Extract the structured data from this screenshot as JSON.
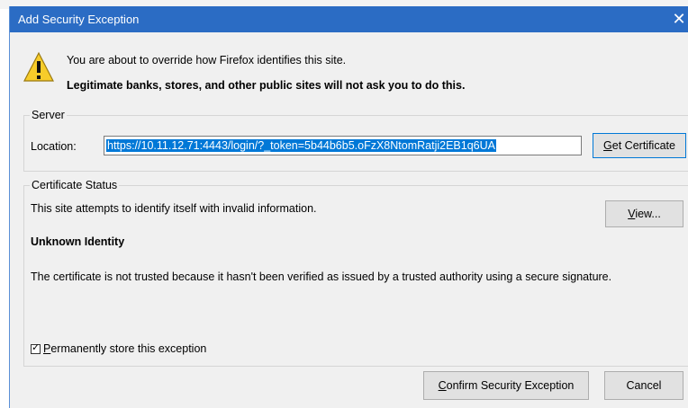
{
  "dialog": {
    "title": "Add Security Exception",
    "close_glyph": "✕"
  },
  "warning": {
    "icon": "warning-triangle-icon",
    "line1": "You are about to override how Firefox identifies this site.",
    "line2": "Legitimate banks, stores, and other public sites will not ask you to do this."
  },
  "server": {
    "legend": "Server",
    "location_label": "Location:",
    "location_value": "https://10.11.12.71:4443/login/?_token=5b44b6b5.oFzX8NtomRatji2EB1q6UA",
    "get_certificate_first": "G",
    "get_certificate_rest": "et Certificate"
  },
  "status": {
    "legend": "Certificate Status",
    "message": "This site attempts to identify itself with invalid information.",
    "view_first": "V",
    "view_rest": "iew...",
    "identity_heading": "Unknown Identity",
    "trust_message": "The certificate is not trusted because it hasn't been verified as issued by a trusted authority using a secure signature.",
    "permanent_first": "P",
    "permanent_rest": "ermanently store this exception",
    "permanent_checked": true
  },
  "buttons": {
    "confirm_first": "C",
    "confirm_rest": "onfirm Security Exception",
    "cancel": "Cancel"
  },
  "colors": {
    "titlebar": "#2b6cc4",
    "selection": "#0078d7",
    "dialog_bg": "#f0f0f0"
  }
}
